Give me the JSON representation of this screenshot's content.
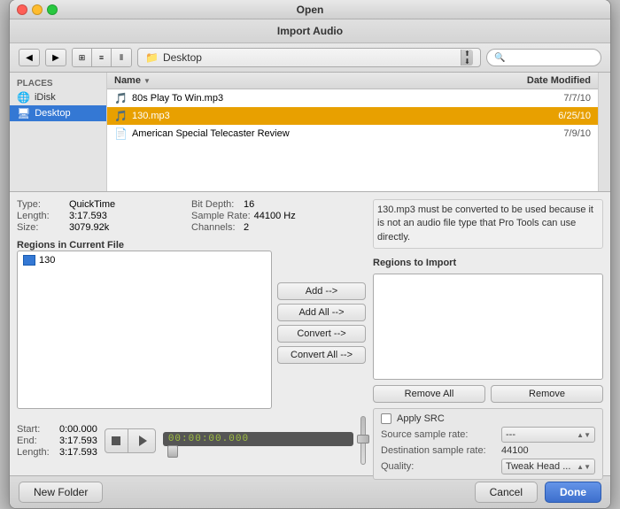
{
  "window": {
    "title": "Open",
    "sheet_title": "Import Audio"
  },
  "toolbar": {
    "location": "Desktop",
    "search_placeholder": ""
  },
  "sidebar": {
    "sections": [
      {
        "label": "PLACES",
        "items": [
          {
            "id": "idisk",
            "label": "iDisk",
            "icon": "🌐"
          },
          {
            "id": "desktop",
            "label": "Desktop",
            "icon": "🖥",
            "active": true
          }
        ]
      }
    ]
  },
  "file_list": {
    "columns": [
      {
        "label": "Name",
        "has_arrow": true
      },
      {
        "label": "Date Modified"
      }
    ],
    "files": [
      {
        "id": "file1",
        "name": "80s Play To Win.mp3",
        "date": "7/7/10",
        "icon": "🎵",
        "selected": false
      },
      {
        "id": "file2",
        "name": "130.mp3",
        "date": "6/25/10",
        "icon": "🎵",
        "selected": true
      },
      {
        "id": "file3",
        "name": "American Special Telecaster Review",
        "date": "7/9/10",
        "icon": "📄",
        "selected": false
      }
    ]
  },
  "file_info": {
    "type_label": "Type:",
    "type_value": "QuickTime",
    "length_label": "Length:",
    "length_value": "3:17.593",
    "size_label": "Size:",
    "size_value": "3079.92k",
    "bit_depth_label": "Bit Depth:",
    "bit_depth_value": "16",
    "sample_rate_label": "Sample Rate:",
    "sample_rate_value": "44100 Hz",
    "channels_label": "Channels:",
    "channels_value": "2"
  },
  "info_message": "130.mp3 must be converted to be used because it is not an audio file type that Pro Tools can use directly.",
  "regions": {
    "current_label": "Regions in Current File",
    "import_label": "Regions to Import",
    "items": [
      {
        "id": "r1",
        "name": "130"
      }
    ]
  },
  "buttons": {
    "add": "Add -->",
    "add_all": "Add All -->",
    "convert": "Convert -->",
    "convert_all": "Convert All -->",
    "remove_all": "Remove All",
    "remove": "Remove"
  },
  "transport": {
    "start_label": "Start:",
    "start_value": "0:00.000",
    "end_label": "End:",
    "end_value": "3:17.593",
    "length_label": "Length:",
    "length_value": "3:17.593",
    "timecode": "00:00:00.000"
  },
  "src": {
    "apply_label": "Apply SRC",
    "source_label": "Source sample rate:",
    "source_value": "---",
    "dest_label": "Destination sample rate:",
    "dest_value": "44100",
    "quality_label": "Quality:",
    "quality_value": "Tweak Head ..."
  },
  "bottom_buttons": {
    "new_folder": "New Folder",
    "cancel": "Cancel",
    "done": "Done"
  }
}
